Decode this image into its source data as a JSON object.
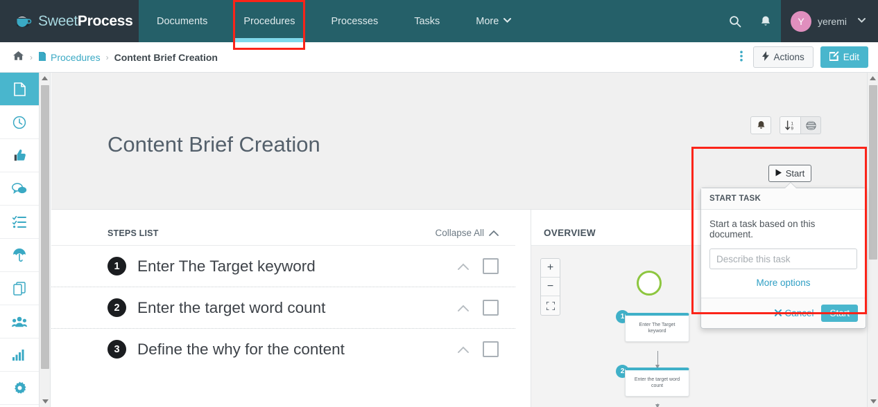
{
  "brand": {
    "part1": "Sweet",
    "part2": "Process",
    "icon": "coffee-cup-icon"
  },
  "topnav": {
    "items": [
      {
        "label": "Documents",
        "active": false
      },
      {
        "label": "Procedures",
        "active": true
      },
      {
        "label": "Processes",
        "active": false
      },
      {
        "label": "Tasks",
        "active": false
      },
      {
        "label": "More",
        "active": false,
        "caret": "⌄"
      }
    ],
    "search_icon": "search-icon",
    "bell_icon": "bell-icon",
    "user": {
      "initial": "Y",
      "name": "yeremi",
      "caret": "⌄"
    }
  },
  "breadcrumb": {
    "home_icon": "home-icon",
    "sep": "›",
    "doc_icon": "file-icon",
    "parent": "Procedures",
    "current": "Content Brief Creation",
    "kebab": "⋮",
    "actions_label": "Actions",
    "actions_icon": "bolt-icon",
    "edit_label": "Edit",
    "edit_icon": "pencil-square-icon"
  },
  "rail": {
    "items": [
      {
        "name": "document",
        "glyph": "📄",
        "active": true
      },
      {
        "name": "history",
        "glyph": "🕒",
        "active": false
      },
      {
        "name": "approvals",
        "glyph": "👍",
        "active": false
      },
      {
        "name": "comments",
        "glyph": "💬",
        "active": false
      },
      {
        "name": "checklist",
        "glyph": "≣",
        "active": false
      },
      {
        "name": "umbrella",
        "glyph": "☂",
        "active": false
      },
      {
        "name": "duplicate",
        "glyph": "❐",
        "active": false
      },
      {
        "name": "teams",
        "glyph": "👥",
        "active": false
      },
      {
        "name": "reports",
        "glyph": "📊",
        "active": false
      },
      {
        "name": "settings",
        "glyph": "⚙",
        "active": false
      }
    ]
  },
  "document": {
    "title": "Content Brief Creation",
    "tools": [
      {
        "name": "notify-button",
        "icon": "bell-icon"
      },
      {
        "name": "sort-button",
        "icon": "sort-amount-icon"
      },
      {
        "name": "globe-button",
        "icon": "globe-icon"
      }
    ]
  },
  "steps_panel": {
    "heading": "STEPS LIST",
    "collapse_all": "Collapse All",
    "collapse_caret": "⌃",
    "steps": [
      {
        "number": "1",
        "title": "Enter The Target keyword"
      },
      {
        "number": "2",
        "title": "Enter the target word count"
      },
      {
        "number": "3",
        "title": "Define the why for the content"
      }
    ]
  },
  "overview_panel": {
    "heading": "OVERVIEW",
    "zoom_in": "+",
    "zoom_out": "−",
    "fit": "⛶",
    "nodes": [
      {
        "number": "1",
        "label": "Enter The Target keyword"
      },
      {
        "number": "2",
        "label": "Enter the target word count"
      }
    ]
  },
  "start_popover": {
    "trigger_label": "Start",
    "trigger_icon": "play-icon",
    "heading": "START TASK",
    "description": "Start a task based on this document.",
    "input_value": "",
    "input_placeholder": "Describe this task",
    "more_options": "More options",
    "cancel_label": "Cancel",
    "cancel_icon": "x-icon",
    "confirm_label": "Start"
  },
  "colors": {
    "nav_bg": "#256069",
    "brand_bg": "#2b3740",
    "accent": "#49b6cd",
    "active_underline": "#7fd8ea",
    "annotation": "#fb2419",
    "avatar": "#e08fbe",
    "flow_node_top": "#3fb0c8",
    "flow_start_ring": "#8dc63f"
  }
}
